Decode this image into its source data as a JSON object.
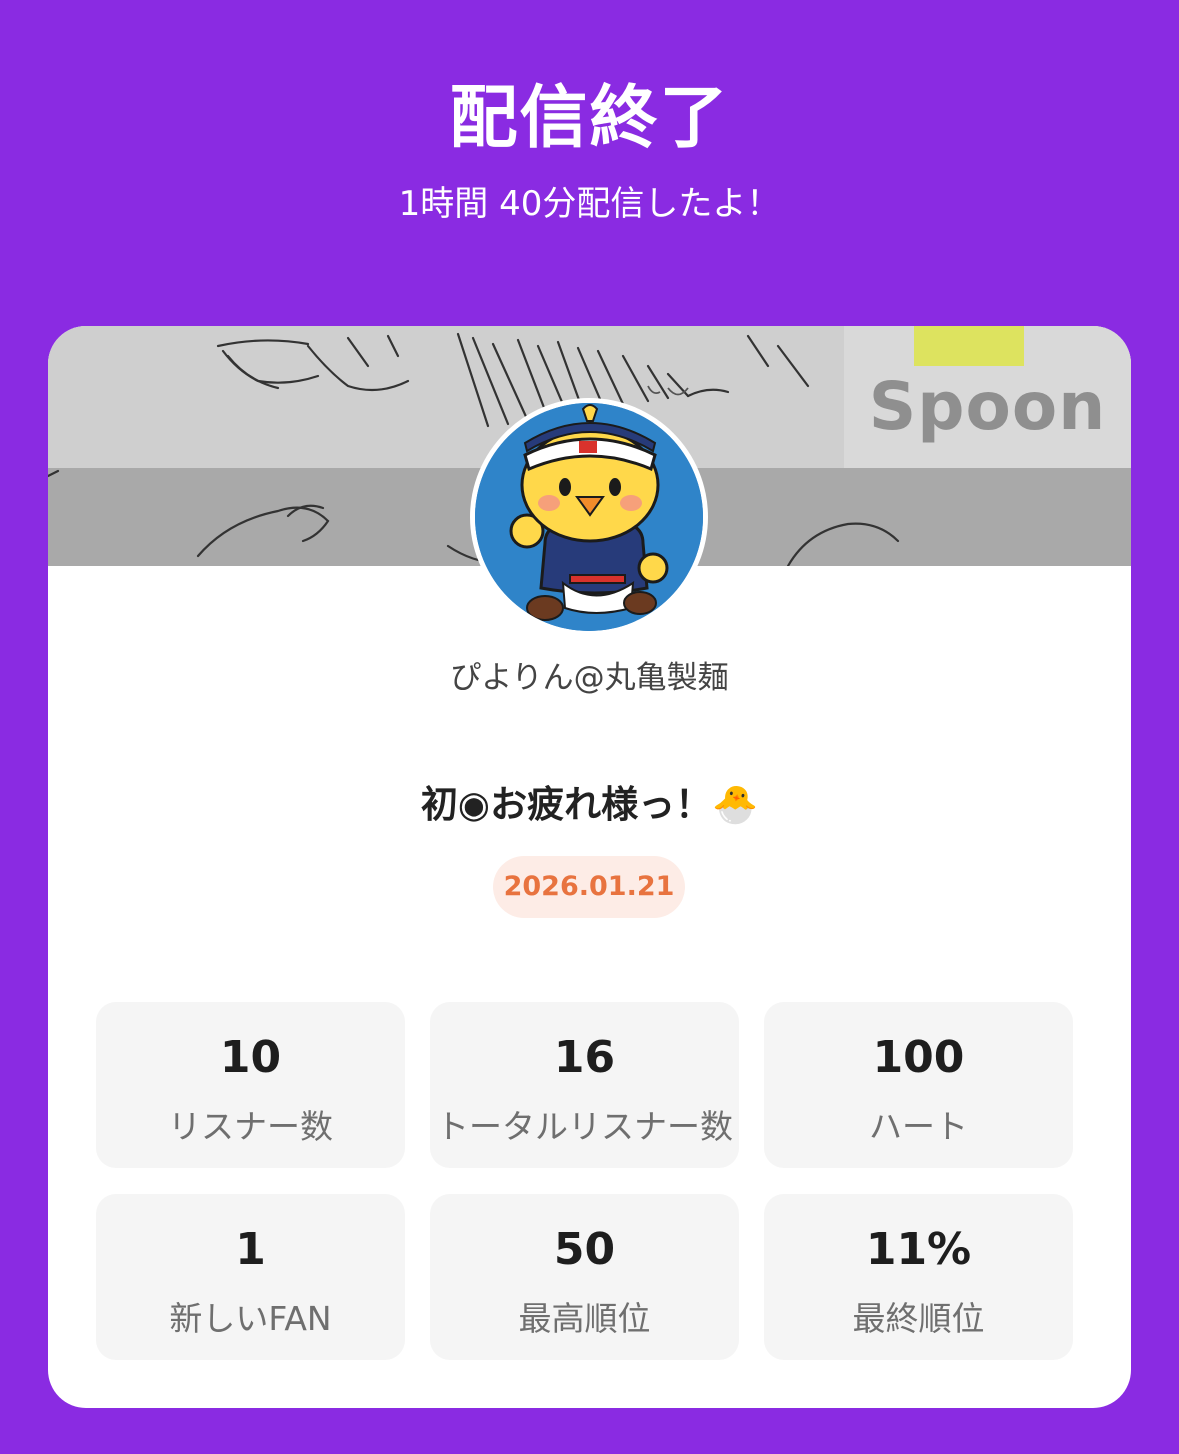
{
  "header": {
    "title": "配信終了",
    "subtitle": "1時間 40分配信したよ！"
  },
  "banner": {
    "logo_text": "Spoon"
  },
  "profile": {
    "username": "ぴよりん@丸亀製麺"
  },
  "message": "初◉お疲れ様っ！🐣",
  "date": "2026.01.21",
  "stats": [
    {
      "value": "10",
      "label": "リスナー数"
    },
    {
      "value": "16",
      "label": "トータルリスナー数"
    },
    {
      "value": "100",
      "label": "ハート"
    },
    {
      "value": "1",
      "label": "新しいFAN"
    },
    {
      "value": "50",
      "label": "最高順位"
    },
    {
      "value": "11%",
      "label": "最終順位"
    }
  ],
  "colors": {
    "background": "#8a2be2",
    "card": "#ffffff",
    "date_text": "#e8733f",
    "date_bg": "#fdece6"
  }
}
